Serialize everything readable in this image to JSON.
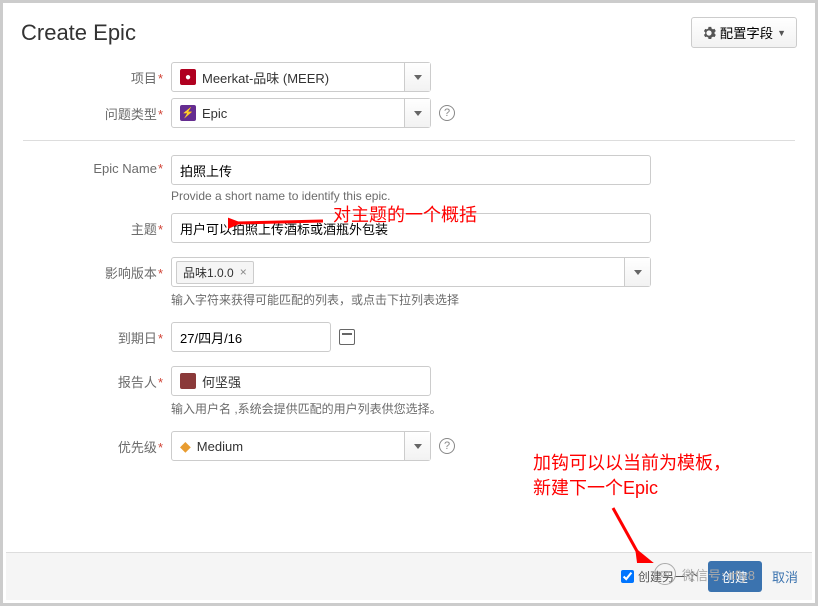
{
  "header": {
    "title": "Create Epic",
    "config_label": "配置字段"
  },
  "fields": {
    "project": {
      "label": "项目",
      "value": "Meerkat-品味 (MEER)"
    },
    "issue_type": {
      "label": "问题类型",
      "value": "Epic"
    },
    "epic_name": {
      "label": "Epic Name",
      "value": "拍照上传",
      "hint": "Provide a short name to identify this epic."
    },
    "summary": {
      "label": "主题",
      "value": "用户可以拍照上传酒标或酒瓶外包装"
    },
    "affects_version": {
      "label": "影响版本",
      "tag": "品味1.0.0",
      "hint": "输入字符来获得可能匹配的列表，或点击下拉列表选择"
    },
    "due_date": {
      "label": "到期日",
      "value": "27/四月/16"
    },
    "reporter": {
      "label": "报告人",
      "value": "何坚强",
      "hint": "输入用户名 ,系统会提供匹配的用户列表供您选择。"
    },
    "priority": {
      "label": "优先级",
      "value": "Medium"
    }
  },
  "footer": {
    "create_another": "创建另一个",
    "submit": "创建",
    "cancel": "取消"
  },
  "annotations": {
    "epic_name_note": "对主题的一个概括",
    "checkbox_note_l1": "加钩可以以当前为模板，",
    "checkbox_note_l2": "新建下一个Epic"
  },
  "watermark": {
    "text": "微信号: itfly8"
  }
}
